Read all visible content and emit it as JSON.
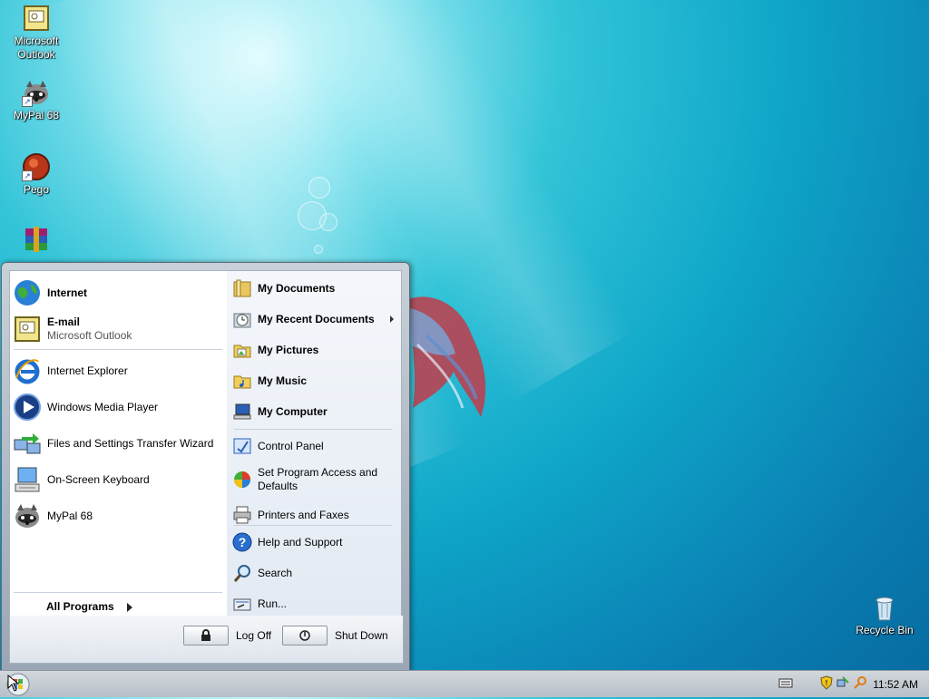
{
  "desktop": {
    "icons": [
      {
        "label_line1": "Microsoft",
        "label_line2": "Outlook",
        "icon": "outlook-icon"
      },
      {
        "label_line1": "MyPal 68",
        "label_line2": "",
        "icon": "raccoon-icon"
      },
      {
        "label_line1": "Pego",
        "label_line2": "",
        "icon": "pego-icon"
      },
      {
        "label_line1": "",
        "label_line2": "",
        "icon": "winrar-icon"
      }
    ],
    "recycle_bin": "Recycle Bin"
  },
  "start_menu": {
    "pinned": [
      {
        "title": "Internet",
        "subtitle": "",
        "icon": "globe-icon"
      },
      {
        "title": "E-mail",
        "subtitle": "Microsoft Outlook",
        "icon": "outlook-icon"
      }
    ],
    "recent": [
      {
        "label": "Internet Explorer",
        "icon": "ie-icon"
      },
      {
        "label": "Windows Media Player",
        "icon": "media-player-icon"
      },
      {
        "label": "Files and Settings Transfer Wizard",
        "icon": "transfer-wizard-icon"
      },
      {
        "label": "On-Screen Keyboard",
        "icon": "keyboard-icon"
      },
      {
        "label": "MyPal 68",
        "icon": "raccoon-icon"
      }
    ],
    "all_programs": "All Programs",
    "right": [
      {
        "label": "My Documents",
        "bold": true,
        "icon": "documents-folder-icon"
      },
      {
        "label": "My Recent Documents",
        "bold": true,
        "icon": "recent-docs-icon",
        "submenu": true
      },
      {
        "label": "My Pictures",
        "bold": true,
        "icon": "pictures-folder-icon"
      },
      {
        "label": "My Music",
        "bold": true,
        "icon": "music-folder-icon"
      },
      {
        "label": "My Computer",
        "bold": true,
        "icon": "computer-icon"
      },
      {
        "label": "Control Panel",
        "icon": "control-panel-icon"
      },
      {
        "label": "Set Program Access and Defaults",
        "line1": "Set Program Access and",
        "line2": "Defaults",
        "icon": "program-access-icon"
      },
      {
        "label": "Printers and Faxes",
        "icon": "printer-icon"
      },
      {
        "label": "Help and Support",
        "icon": "help-icon"
      },
      {
        "label": "Search",
        "icon": "search-icon"
      },
      {
        "label": "Run...",
        "icon": "run-icon"
      }
    ],
    "log_off": "Log Off",
    "shut_down": "Shut Down"
  },
  "taskbar": {
    "clock": "11:52 AM",
    "tray_icons": [
      "keyboard-tray-icon",
      "security-shield-icon",
      "network-icon",
      "search-tray-icon"
    ]
  }
}
